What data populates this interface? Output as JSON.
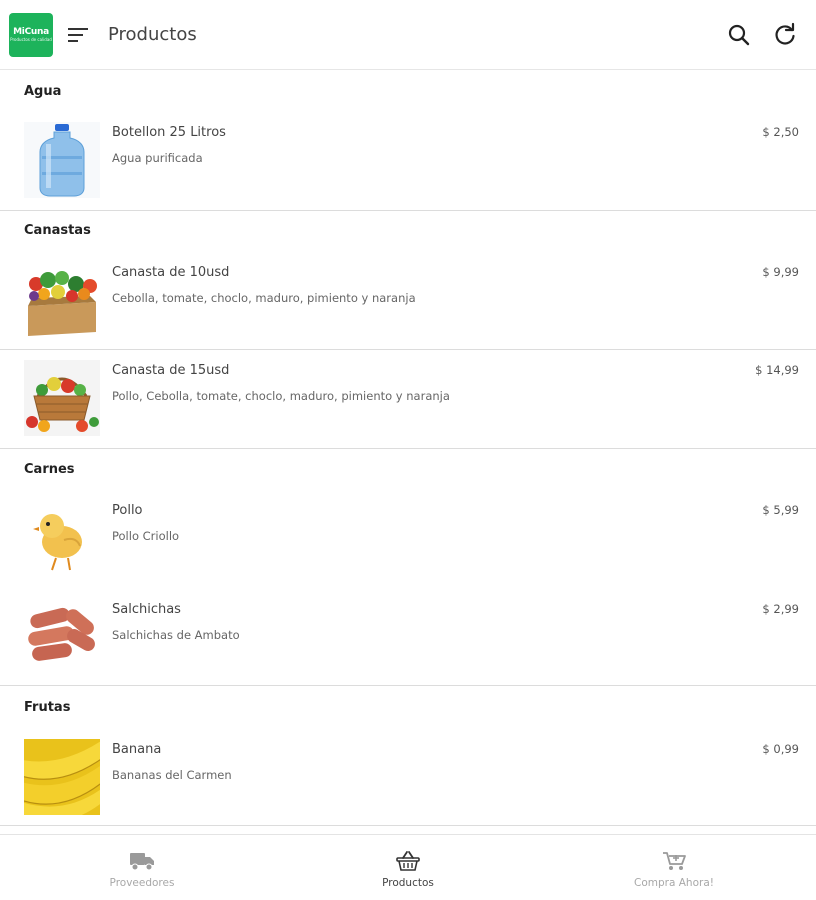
{
  "app": {
    "logo_main": "MiCuna",
    "logo_sub": "Productos de calidad",
    "brand_color": "#1db35b"
  },
  "header": {
    "title": "Productos",
    "menu_icon": "menu-icon",
    "search_icon": "search-icon",
    "refresh_icon": "refresh-icon"
  },
  "groups": [
    {
      "title": "Agua",
      "items": [
        {
          "name": "Botellon 25 Litros",
          "desc": "Agua purificada",
          "price": "$ 2,50",
          "image": "water-jug"
        }
      ]
    },
    {
      "title": "Canastas",
      "items": [
        {
          "name": "Canasta de 10usd",
          "desc": "Cebolla, tomate, choclo, maduro, pimiento y naranja",
          "price": "$ 9,99",
          "image": "vegetable-box"
        },
        {
          "name": "Canasta de 15usd",
          "desc": "Pollo, Cebolla, tomate, choclo, maduro, pimiento y naranja",
          "price": "$ 14,99",
          "image": "vegetable-basket"
        }
      ]
    },
    {
      "title": "Carnes",
      "items": [
        {
          "name": "Pollo",
          "desc": "Pollo Criollo",
          "price": "$ 5,99",
          "image": "chick"
        },
        {
          "name": "Salchichas",
          "desc": "Salchichas de Ambato",
          "price": "$ 2,99",
          "image": "sausages"
        }
      ]
    },
    {
      "title": "Frutas",
      "items": [
        {
          "name": "Banana",
          "desc": "Bananas del Carmen",
          "price": "$ 0,99",
          "image": "bananas"
        }
      ]
    }
  ],
  "bottom_nav": [
    {
      "label": "Proveedores",
      "icon": "truck-icon",
      "active": false
    },
    {
      "label": "Productos",
      "icon": "basket-icon",
      "active": true
    },
    {
      "label": "Compra Ahora!",
      "icon": "cart-icon",
      "active": false
    }
  ]
}
